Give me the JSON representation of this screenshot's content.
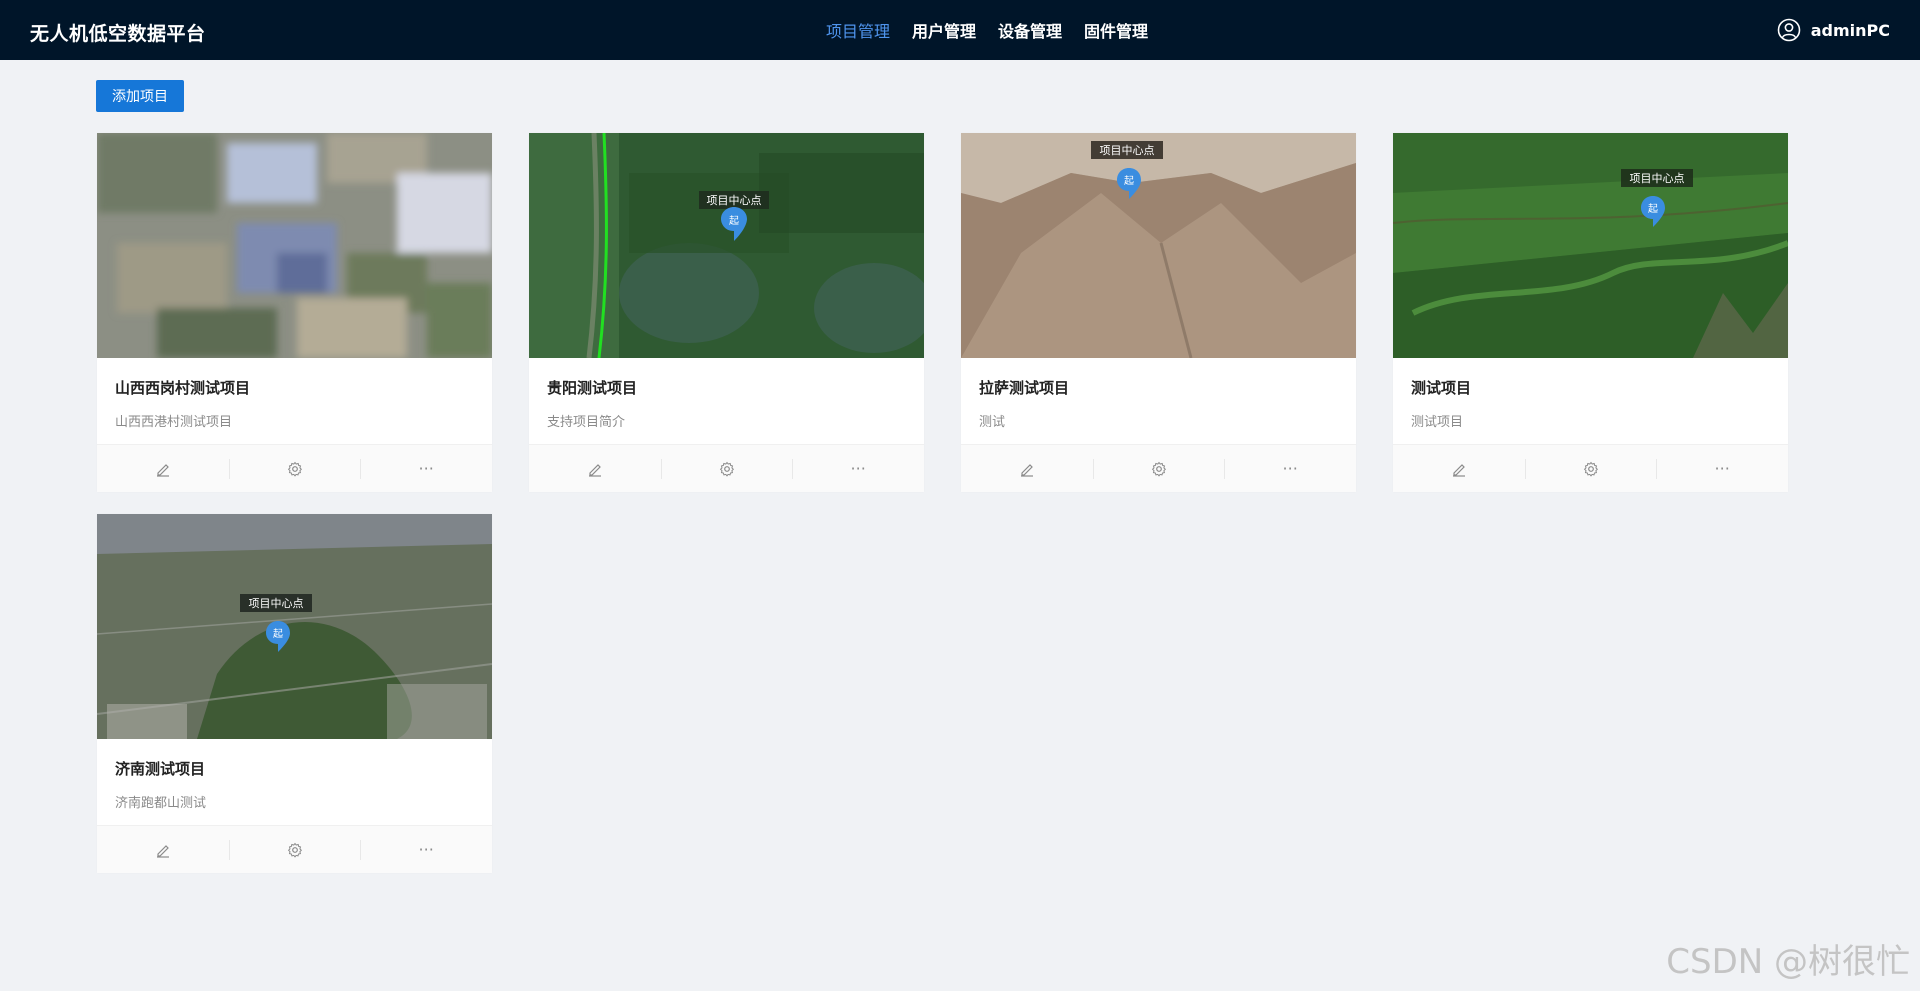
{
  "app": {
    "title": "无人机低空数据平台"
  },
  "nav": {
    "items": [
      {
        "label": "项目管理",
        "active": true
      },
      {
        "label": "用户管理",
        "active": false
      },
      {
        "label": "设备管理",
        "active": false
      },
      {
        "label": "固件管理",
        "active": false
      }
    ]
  },
  "user": {
    "name": "adminPC",
    "icon": "user-circle-icon"
  },
  "toolbar": {
    "add_label": "添加项目"
  },
  "colors": {
    "header_bg": "#001529",
    "nav_active": "#4f95ee",
    "primary": "#1677d8",
    "page_bg": "#f0f2f5"
  },
  "projects": [
    {
      "title": "山西西岗村测试项目",
      "desc": "山西西港村测试项目",
      "map_label": "",
      "pin_label": ""
    },
    {
      "title": "贵阳测试项目",
      "desc": "支持项目简介",
      "map_label": "项目中心点",
      "pin_label": "起"
    },
    {
      "title": "拉萨测试项目",
      "desc": "测试",
      "map_label": "项目中心点",
      "pin_label": "起"
    },
    {
      "title": "测试项目",
      "desc": "测试项目",
      "map_label": "项目中心点",
      "pin_label": "起"
    },
    {
      "title": "济南测试项目",
      "desc": "济南跑都山测试",
      "map_label": "项目中心点",
      "pin_label": "起"
    }
  ],
  "actions": [
    {
      "icon": "edit-icon"
    },
    {
      "icon": "gear-icon"
    },
    {
      "icon": "more-icon",
      "glyph": "···"
    }
  ],
  "watermark": "CSDN @树很忙"
}
